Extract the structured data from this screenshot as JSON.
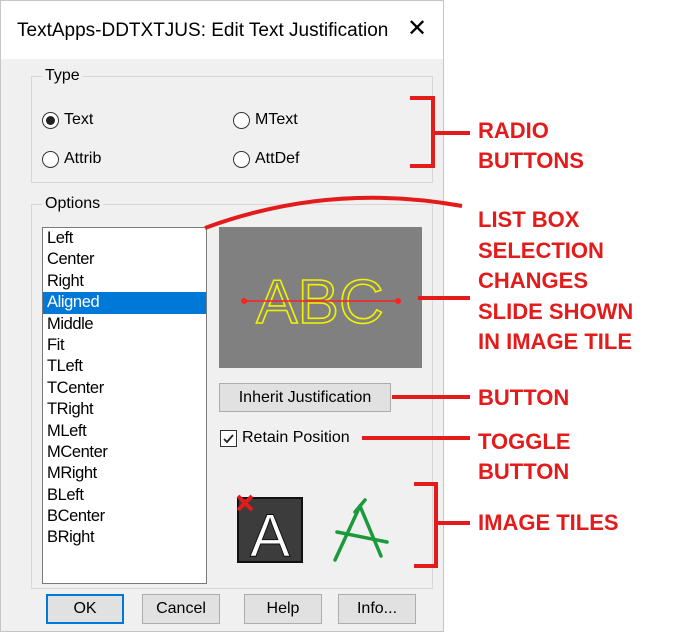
{
  "window": {
    "title": "TextApps-DDTXTJUS: Edit Text Justification",
    "close_glyph": "✕"
  },
  "type_group": {
    "legend": "Type",
    "options": [
      {
        "label": "Text",
        "selected": true
      },
      {
        "label": "MText",
        "selected": false
      },
      {
        "label": "Attrib",
        "selected": false
      },
      {
        "label": "AttDef",
        "selected": false
      }
    ]
  },
  "options_group": {
    "legend": "Options",
    "list_items": [
      "Left",
      "Center",
      "Right",
      "Aligned",
      "Middle",
      "Fit",
      "TLeft",
      "TCenter",
      "TRight",
      "MLeft",
      "MCenter",
      "MRight",
      "BLeft",
      "BCenter",
      "BRight"
    ],
    "selected_item": "Aligned",
    "preview_text": "ABC",
    "inherit_button": "Inherit Justification",
    "retain_toggle": {
      "label": "Retain Position",
      "checked": true
    }
  },
  "image_tiles": [
    "text-a-clear-icon",
    "text-a-snap-icon"
  ],
  "footer_buttons": {
    "ok": "OK",
    "cancel": "Cancel",
    "help": "Help",
    "info": "Info..."
  },
  "annotations": {
    "radio_buttons": [
      "RADIO",
      "BUTTONS"
    ],
    "list_box": [
      "LIST BOX",
      "SELECTION",
      "CHANGES",
      "SLIDE SHOWN",
      "IN IMAGE TILE"
    ],
    "button": [
      "BUTTON"
    ],
    "toggle_button": [
      "TOGGLE",
      "BUTTON"
    ],
    "image_tiles": [
      "IMAGE TILES"
    ]
  },
  "colors": {
    "annotation": "#e31b1b",
    "selection": "#0078d7",
    "preview_bg": "#808080",
    "preview_text": "#f2f200"
  }
}
